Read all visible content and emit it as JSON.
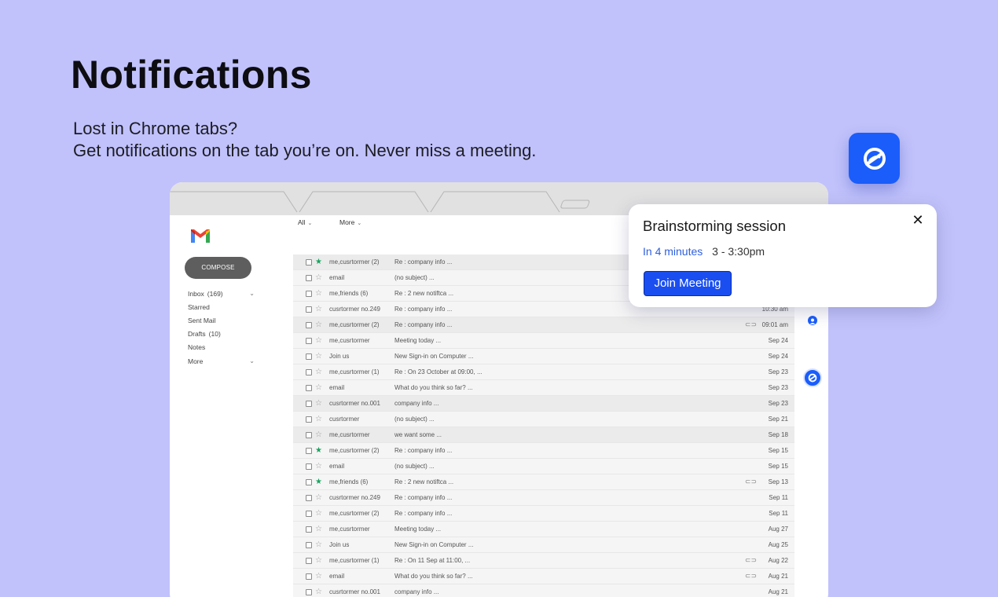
{
  "hero": {
    "title": "Notifications",
    "subtitle_line1": "Lost in Chrome tabs?",
    "subtitle_line2": "Get notifications on the tab you’re on. Never miss a meeting."
  },
  "colors": {
    "background": "#c1c2fb",
    "brand_blue": "#1a5dfb",
    "join_button": "#1a4ef0",
    "link_blue": "#2f5fdc",
    "starred_green": "#1aa260"
  },
  "gmail": {
    "compose_label": "COMPOSE",
    "nav": [
      {
        "label": "Inbox",
        "count": "(169)",
        "expand": "chevron-down-icon"
      },
      {
        "label": "Starred",
        "count": "",
        "expand": ""
      },
      {
        "label": "Sent Mail",
        "count": "",
        "expand": ""
      },
      {
        "label": "Drafts",
        "count": "(10)",
        "expand": ""
      },
      {
        "label": "Notes",
        "count": "",
        "expand": ""
      },
      {
        "label": "More",
        "count": "",
        "expand": "chevron-down-icon"
      }
    ],
    "toolbar": {
      "all_label": "All",
      "more_label": "More"
    },
    "rows": [
      {
        "sender": "me,cusrtormer (2)",
        "subject": "Re : company info ...",
        "date": "",
        "starred": true,
        "unread": true,
        "clip": false
      },
      {
        "sender": "email",
        "subject": "(no subject) ...",
        "date": "",
        "starred": false,
        "unread": false,
        "clip": false
      },
      {
        "sender": "me,friends (6)",
        "subject": "Re : 2 new notiftca ...",
        "date": "",
        "starred": false,
        "unread": false,
        "clip": false
      },
      {
        "sender": "cusrtormer no.249",
        "subject": "Re : company info ...",
        "date": "10:30 am",
        "starred": false,
        "unread": false,
        "clip": false
      },
      {
        "sender": "me,cusrtormer (2)",
        "subject": "Re : company info ...",
        "date": "09:01 am",
        "starred": false,
        "unread": true,
        "clip": true
      },
      {
        "sender": "me,cusrtormer",
        "subject": "Meeting today ...",
        "date": "Sep 24",
        "starred": false,
        "unread": false,
        "clip": false
      },
      {
        "sender": "Join us",
        "subject": "New Sign-in on Computer ...",
        "date": "Sep 24",
        "starred": false,
        "unread": false,
        "clip": false
      },
      {
        "sender": "me,cusrtormer (1)",
        "subject": "Re : On 23 October at 09:00, ...",
        "date": "Sep 23",
        "starred": false,
        "unread": false,
        "clip": false
      },
      {
        "sender": "email",
        "subject": "What do you think so far? ...",
        "date": "Sep 23",
        "starred": false,
        "unread": false,
        "clip": false
      },
      {
        "sender": "cusrtormer no.001",
        "subject": "company info ...",
        "date": "Sep 23",
        "starred": false,
        "unread": true,
        "clip": false
      },
      {
        "sender": "cusrtormer",
        "subject": "(no subject) ...",
        "date": "Sep 21",
        "starred": false,
        "unread": false,
        "clip": false
      },
      {
        "sender": "me,cusrtormer",
        "subject": "we want some ...",
        "date": "Sep 18",
        "starred": false,
        "unread": true,
        "clip": false
      },
      {
        "sender": "me,cusrtormer (2)",
        "subject": "Re : company info ...",
        "date": "Sep 15",
        "starred": true,
        "unread": false,
        "clip": false
      },
      {
        "sender": "email",
        "subject": "(no subject) ...",
        "date": "Sep 15",
        "starred": false,
        "unread": false,
        "clip": false
      },
      {
        "sender": "me,friends (6)",
        "subject": "Re : 2 new notiftca ...",
        "date": "Sep 13",
        "starred": true,
        "unread": false,
        "clip": true
      },
      {
        "sender": "cusrtormer no.249",
        "subject": "Re : company info ...",
        "date": "Sep 11",
        "starred": false,
        "unread": false,
        "clip": false
      },
      {
        "sender": "me,cusrtormer (2)",
        "subject": "Re : company info ...",
        "date": "Sep 11",
        "starred": false,
        "unread": false,
        "clip": false
      },
      {
        "sender": "me,cusrtormer",
        "subject": "Meeting today ...",
        "date": "Aug 27",
        "starred": false,
        "unread": false,
        "clip": false
      },
      {
        "sender": "Join us",
        "subject": "New Sign-in on Computer ...",
        "date": "Aug 25",
        "starred": false,
        "unread": false,
        "clip": false
      },
      {
        "sender": "me,cusrtormer (1)",
        "subject": "Re : On 11 Sep at 11:00, ...",
        "date": "Aug 22",
        "starred": false,
        "unread": false,
        "clip": true
      },
      {
        "sender": "email",
        "subject": "What do you think so far? ...",
        "date": "Aug 21",
        "starred": false,
        "unread": false,
        "clip": true
      },
      {
        "sender": "cusrtormer no.001",
        "subject": "company info ...",
        "date": "Aug 21",
        "starred": false,
        "unread": false,
        "clip": false
      }
    ]
  },
  "notification": {
    "title": "Brainstorming session",
    "relative_time": "In 4 minutes",
    "time_range": "3 - 3:30pm",
    "join_label": "Join Meeting",
    "close_icon": "close-icon"
  }
}
